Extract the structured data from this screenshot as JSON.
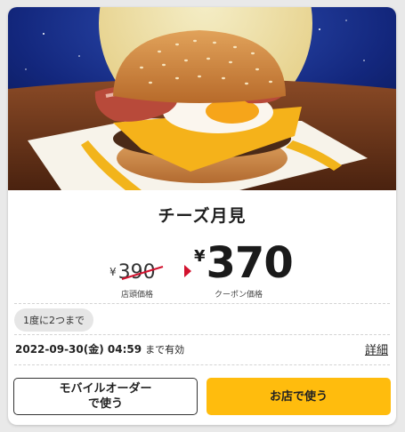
{
  "product": {
    "name": "チーズ月見",
    "image_alt": "cheese tsukimi burger photo"
  },
  "pricing": {
    "currency_symbol": "¥",
    "old_price": "390",
    "old_price_label": "店頭価格",
    "coupon_price": "370",
    "coupon_price_label": "クーポン価格"
  },
  "coupon": {
    "usage_limit": "1度に2つまで",
    "expiry_date": "2022-09-30(金) 04:59",
    "expiry_suffix": "まで有効",
    "details_link": "詳細"
  },
  "actions": {
    "mobile_order_line1": "モバイルオーダー",
    "mobile_order_line2": "で使う",
    "use_in_store": "お店で使う"
  },
  "colors": {
    "accent_yellow": "#ffbc0d",
    "accent_red": "#d2122e",
    "night_sky": "#0d1f6b"
  }
}
